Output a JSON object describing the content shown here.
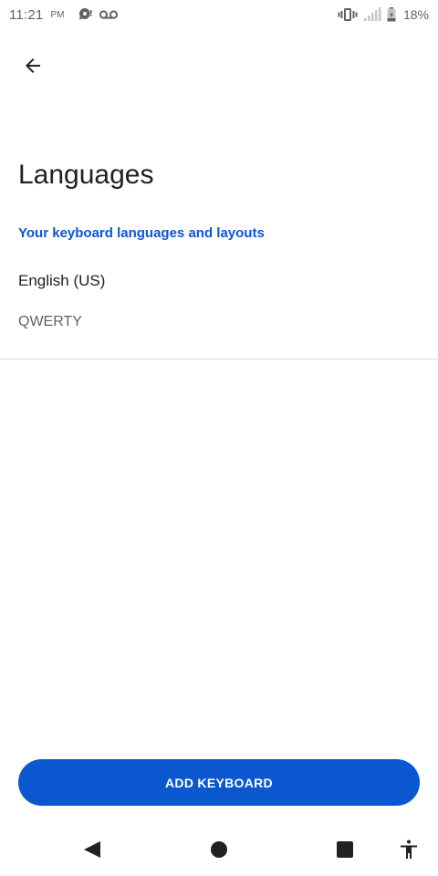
{
  "status_bar": {
    "time": "11:21",
    "ampm": "PM",
    "battery_percent": "18%",
    "icons": [
      "chat-bubble-icon",
      "voicemail-icon",
      "vibrate-icon",
      "signal-icon",
      "battery-icon"
    ]
  },
  "app_bar": {
    "back_icon": "arrow-back-icon"
  },
  "page": {
    "title": "Languages",
    "section_header": "Your keyboard languages and layouts",
    "languages": [
      {
        "language": "English (US)",
        "layout": "QWERTY"
      }
    ]
  },
  "actions": {
    "add_keyboard_label": "ADD KEYBOARD"
  },
  "nav_bar": {
    "icons": [
      "back-triangle-icon",
      "home-circle-icon",
      "recents-square-icon",
      "accessibility-icon"
    ]
  },
  "colors": {
    "accent": "#0b57d0",
    "text_primary": "#202124",
    "text_secondary": "#5f6368",
    "divider": "#dadce0"
  }
}
